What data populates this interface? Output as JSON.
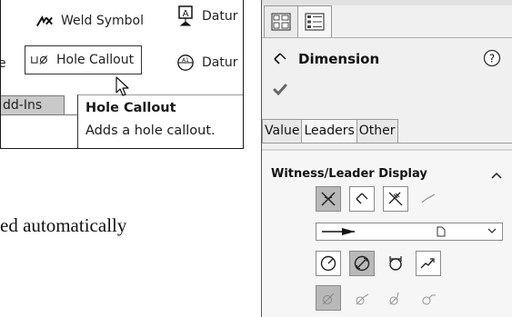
{
  "ribbon": {
    "weld_symbol": "Weld Symbol",
    "datum_1": "Datur",
    "hole_callout": "Hole Callout",
    "datum_2": "Datur",
    "left_fragment": "e",
    "addins": "dd-Ins"
  },
  "tooltip": {
    "title": "Hole Callout",
    "description": "Adds a hole callout."
  },
  "body_text": "ed automatically",
  "property_manager": {
    "title": "Dimension",
    "help_icon": "question-circle-icon",
    "value_tabs": [
      "Value",
      "Leaders",
      "Other"
    ],
    "active_value_tab": "Leaders",
    "group_title": "Witness/Leader Display",
    "colors": {
      "selected_button": "#b9b9b9",
      "panel_background": "#f0f0f0"
    }
  }
}
